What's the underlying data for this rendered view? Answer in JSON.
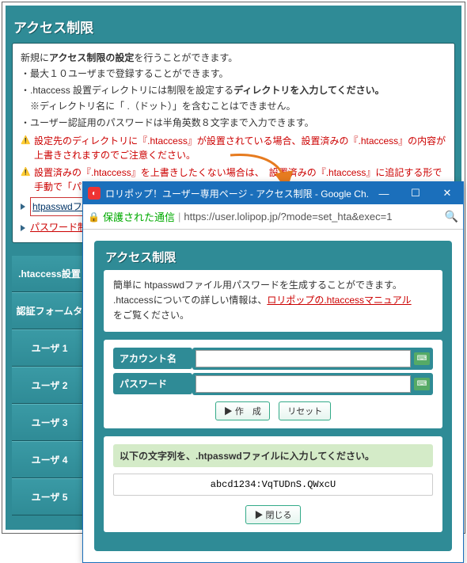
{
  "main": {
    "title": "アクセス制限",
    "intro_prefix": "新規に",
    "intro_bold": "アクセス制限の設定",
    "intro_suffix": "を行うことができます。",
    "bullet1": "・最大１０ユーザまで登録することができます。",
    "bullet2_prefix": "・.htaccess 設置ディレクトリには制限を設定する",
    "bullet2_bold": "ディレクトリを入力してください。",
    "bullet2_note": "　※ディレクトリ名に「 .（ドット）」を含むことはできません。",
    "bullet3": "・ユーザー認証用のパスワードは半角英数８文字まで入力できます。",
    "warn1": "設定先のディレクトリに『.htaccess』が設置されている場合、設置済みの『.htaccess』の内容が上書きされますのでご注意ください。",
    "warn2": "設置済みの『.htaccess』を上書きしたくない場合は、　設置済みの『.htaccess』に追記する形で手動で「パスワード制による制限」の設定を行ってください。",
    "link1": "htpasswdファイル用パスワード生成ツールはコチラ",
    "link2": "パスワード制による制限マニュアルはコチラ"
  },
  "sidebar": {
    "items": [
      ".htaccess設置",
      "認証フォームタ",
      "ユーザ 1",
      "ユーザ 2",
      "ユーザ 3",
      "ユーザ 4",
      "ユーザ 5"
    ]
  },
  "popup": {
    "win_title": "ロリポップ！ユーザー専用ページ - アクセス制限 - Google Ch...",
    "secure": "保護された通信",
    "url": "https://user.lolipop.jp/?mode=set_hta&exec=1",
    "inner_title": "アクセス制限",
    "desc1": "簡単に htpasswdファイル用パスワードを生成することができます。",
    "desc2_prefix": ".htaccessについての詳しい情報は、",
    "desc2_link": "ロリポップの.htaccessマニュアル",
    "desc2_suffix": "をご覧ください。",
    "label_account": "アカウント名",
    "label_password": "パスワード",
    "btn_create": "▶ 作　成",
    "btn_reset": "リセット",
    "result_label": "以下の文字列を、.htpasswdファイルに入力してください。",
    "result_value": "abcd1234:VqTUDnS.QWxcU",
    "btn_close": "▶ 閉じる"
  }
}
